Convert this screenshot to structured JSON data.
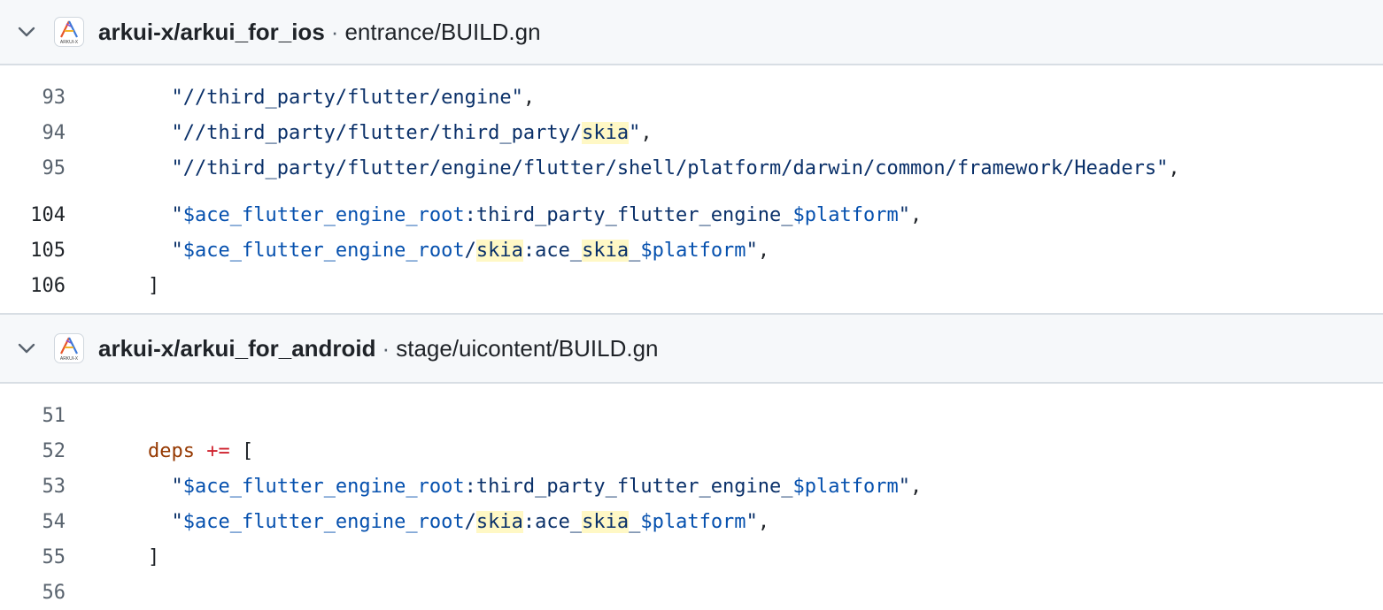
{
  "files": [
    {
      "repo": "arkui-x/arkui_for_ios",
      "separator": "·",
      "path": "entrance/BUILD.gn",
      "avatar_label": "ARKUI-X",
      "lines": [
        {
          "num": "93",
          "indent": "  ",
          "segments": [
            {
              "t": "\"//third_party/flutter/engine\"",
              "c": "str"
            },
            {
              "t": ",",
              "c": ""
            }
          ]
        },
        {
          "num": "94",
          "indent": "  ",
          "segments": [
            {
              "t": "\"//third_party/flutter/third_party/",
              "c": "str"
            },
            {
              "t": "skia",
              "c": "str hl"
            },
            {
              "t": "\"",
              "c": "str"
            },
            {
              "t": ",",
              "c": ""
            }
          ]
        },
        {
          "num": "95",
          "indent": "  ",
          "segments": [
            {
              "t": "\"//third_party/flutter/engine/flutter/shell/platform/darwin/common/framework/Headers\"",
              "c": "str"
            },
            {
              "t": ",",
              "c": ""
            }
          ]
        },
        {
          "num": "104",
          "indent": "  ",
          "segments": [
            {
              "t": "\"",
              "c": "str"
            },
            {
              "t": "$ace_flutter_engine_root",
              "c": "var"
            },
            {
              "t": ":third_party_flutter_engine_",
              "c": "str"
            },
            {
              "t": "$platform",
              "c": "var"
            },
            {
              "t": "\"",
              "c": "str"
            },
            {
              "t": ",",
              "c": ""
            }
          ]
        },
        {
          "num": "105",
          "indent": "  ",
          "segments": [
            {
              "t": "\"",
              "c": "str"
            },
            {
              "t": "$ace_flutter_engine_root",
              "c": "var"
            },
            {
              "t": "/",
              "c": "str"
            },
            {
              "t": "skia",
              "c": "str hl"
            },
            {
              "t": ":ace_",
              "c": "str"
            },
            {
              "t": "skia",
              "c": "str hl"
            },
            {
              "t": "_",
              "c": "str"
            },
            {
              "t": "$platform",
              "c": "var"
            },
            {
              "t": "\"",
              "c": "str"
            },
            {
              "t": ",",
              "c": ""
            }
          ]
        },
        {
          "num": "106",
          "indent": "",
          "segments": [
            {
              "t": "]",
              "c": ""
            }
          ]
        }
      ]
    },
    {
      "repo": "arkui-x/arkui_for_android",
      "separator": "·",
      "path": "stage/uicontent/BUILD.gn",
      "avatar_label": "ARKUI-X",
      "lines": [
        {
          "num": "51",
          "indent": "",
          "segments": []
        },
        {
          "num": "52",
          "indent": "",
          "segments": [
            {
              "t": "deps",
              "c": "kw"
            },
            {
              "t": " ",
              "c": ""
            },
            {
              "t": "+=",
              "c": "op"
            },
            {
              "t": " [",
              "c": ""
            }
          ]
        },
        {
          "num": "53",
          "indent": "  ",
          "segments": [
            {
              "t": "\"",
              "c": "str"
            },
            {
              "t": "$ace_flutter_engine_root",
              "c": "var"
            },
            {
              "t": ":third_party_flutter_engine_",
              "c": "str"
            },
            {
              "t": "$platform",
              "c": "var"
            },
            {
              "t": "\"",
              "c": "str"
            },
            {
              "t": ",",
              "c": ""
            }
          ]
        },
        {
          "num": "54",
          "indent": "  ",
          "segments": [
            {
              "t": "\"",
              "c": "str"
            },
            {
              "t": "$ace_flutter_engine_root",
              "c": "var"
            },
            {
              "t": "/",
              "c": "str"
            },
            {
              "t": "skia",
              "c": "str hl"
            },
            {
              "t": ":ace_",
              "c": "str"
            },
            {
              "t": "skia",
              "c": "str hl"
            },
            {
              "t": "_",
              "c": "str"
            },
            {
              "t": "$platform",
              "c": "var"
            },
            {
              "t": "\"",
              "c": "str"
            },
            {
              "t": ",",
              "c": ""
            }
          ]
        },
        {
          "num": "55",
          "indent": "",
          "segments": [
            {
              "t": "]",
              "c": ""
            }
          ]
        },
        {
          "num": "56",
          "indent": "",
          "segments": []
        }
      ]
    }
  ]
}
